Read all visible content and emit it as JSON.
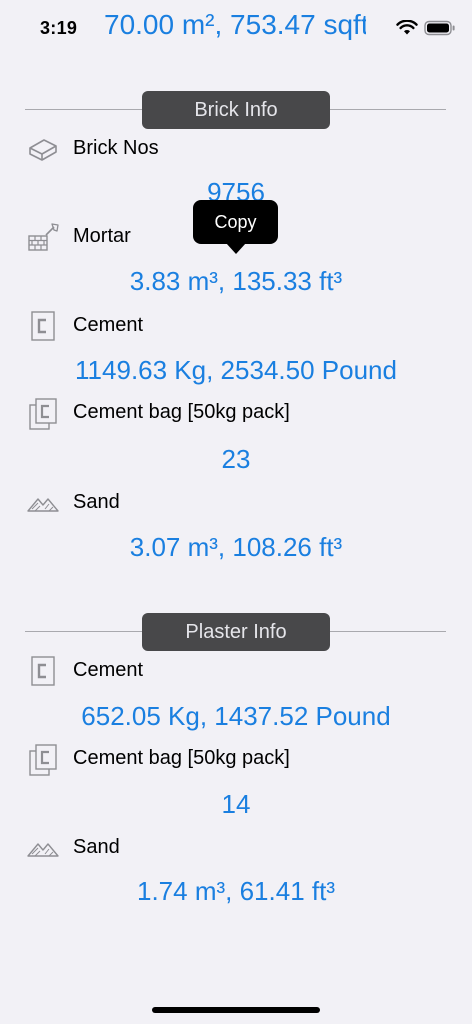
{
  "status": {
    "time": "3:19",
    "area_text": "70.00 m², 753.47 sqft",
    "area_trail": "....."
  },
  "brick_info": {
    "header": "Brick Info",
    "brick_nos": {
      "label": "Brick Nos",
      "value": "9756"
    },
    "mortar": {
      "label": "Mortar",
      "value": "3.83 m³, 135.33 ft³"
    },
    "cement": {
      "label": "Cement",
      "value": "1149.63 Kg, 2534.50 Pound"
    },
    "cement_bag": {
      "label": "Cement bag [50kg pack]",
      "value": "23"
    },
    "sand": {
      "label": "Sand",
      "value": "3.07 m³, 108.26 ft³"
    }
  },
  "plaster_info": {
    "header": "Plaster Info",
    "cement": {
      "label": "Cement",
      "value": "652.05 Kg, 1437.52 Pound"
    },
    "cement_bag": {
      "label": "Cement bag [50kg pack]",
      "value": "14"
    },
    "sand": {
      "label": "Sand",
      "value": "1.74 m³, 61.41 ft³"
    }
  },
  "tooltip": {
    "label": "Copy"
  },
  "icons": {
    "brick": "brick-icon",
    "mortar": "trowel-brick-icon",
    "cement": "cement-icon",
    "cement_bag": "cement-bag-icon",
    "sand": "sand-pile-icon"
  },
  "colors": {
    "value_blue": "#1a7fe0",
    "header_pill": "#48484a",
    "background": "#f2f1f6"
  }
}
